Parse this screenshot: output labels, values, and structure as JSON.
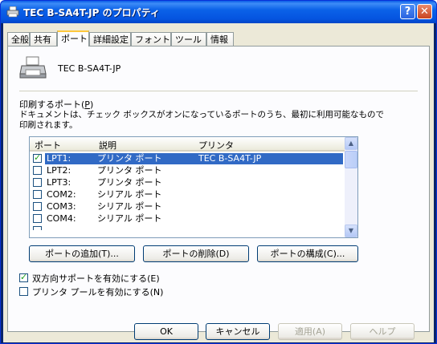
{
  "window": {
    "title": "TEC B-SA4T-JP のプロパティ",
    "help_glyph": "?",
    "close_glyph": "✕"
  },
  "tabs": [
    {
      "label": "全般",
      "active": false
    },
    {
      "label": "共有",
      "active": false
    },
    {
      "label": "ポート",
      "active": true
    },
    {
      "label": "詳細設定",
      "active": false
    },
    {
      "label": "フォント",
      "active": false
    },
    {
      "label": "ツール",
      "active": false
    },
    {
      "label": "情報",
      "active": false
    }
  ],
  "printer": {
    "name": "TEC B-SA4T-JP"
  },
  "ports_section": {
    "label_prefix": "印刷するポート(",
    "label_key": "P",
    "label_suffix": ")",
    "description_line1": "ドキュメントは、チェック ボックスがオンになっているポートのうち、最初に利用可能なもので",
    "description_line2": "印刷されます。"
  },
  "port_list": {
    "columns": {
      "port": "ポート",
      "description": "説明",
      "printer": "プリンタ"
    },
    "rows": [
      {
        "checked": true,
        "port": "LPT1:",
        "description": "プリンタ ポート",
        "printer": "TEC B-SA4T-JP",
        "selected": true
      },
      {
        "checked": false,
        "port": "LPT2:",
        "description": "プリンタ ポート",
        "printer": ""
      },
      {
        "checked": false,
        "port": "LPT3:",
        "description": "プリンタ ポート",
        "printer": ""
      },
      {
        "checked": false,
        "port": "COM2:",
        "description": "シリアル ポート",
        "printer": ""
      },
      {
        "checked": false,
        "port": "COM3:",
        "description": "シリアル ポート",
        "printer": ""
      },
      {
        "checked": false,
        "port": "COM4:",
        "description": "シリアル ポート",
        "printer": ""
      }
    ]
  },
  "buttons": {
    "add_port": "ポートの追加(T)...",
    "delete_port": "ポートの削除(D)",
    "configure_port": "ポートの構成(C)...",
    "ok": "OK",
    "cancel": "キャンセル",
    "apply": "適用(A)",
    "help": "ヘルプ"
  },
  "options": {
    "bidirectional": {
      "label": "双方向サポートを有効にする(E)",
      "checked": true
    },
    "pooling": {
      "label": "プリンタ プールを有効にする(N)",
      "checked": false
    }
  }
}
